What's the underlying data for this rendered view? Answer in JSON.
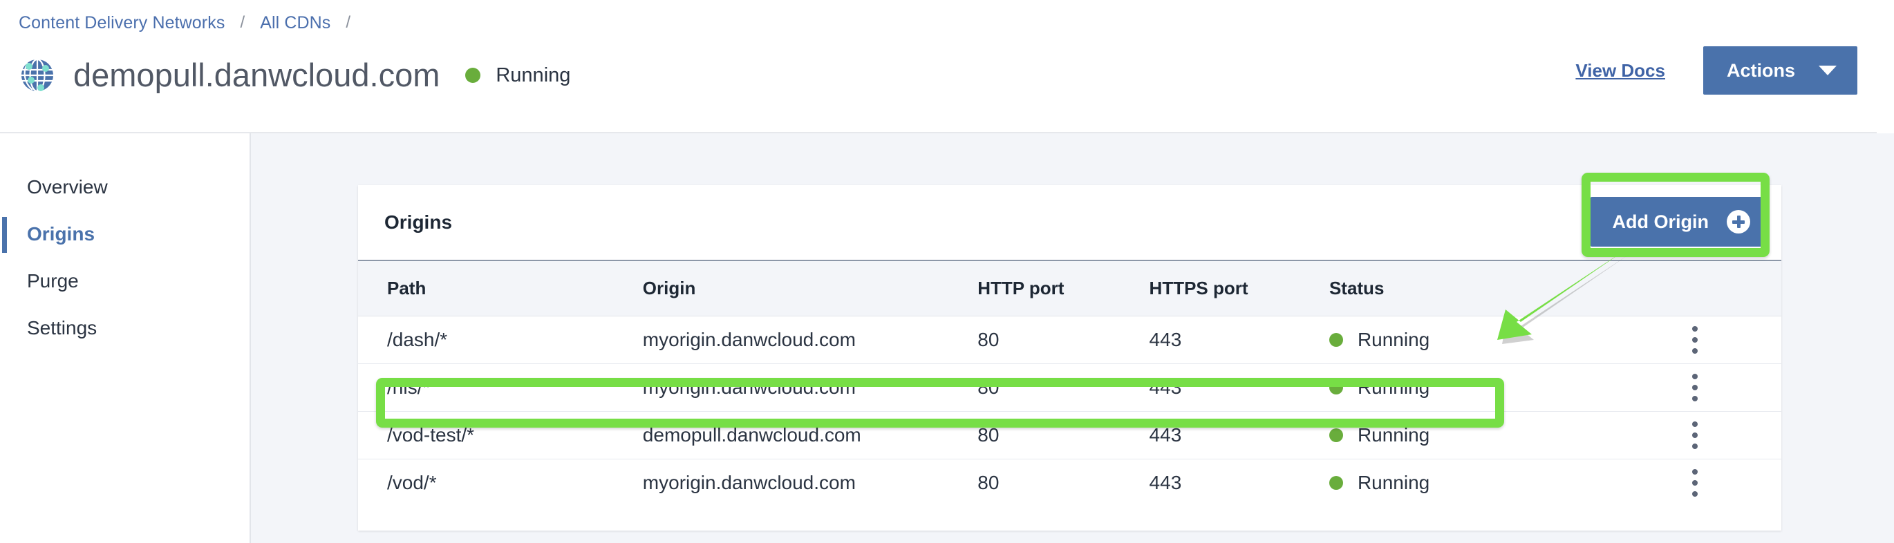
{
  "breadcrumb": {
    "items": [
      {
        "label": "Content Delivery Networks"
      },
      {
        "label": "All CDNs"
      }
    ],
    "separator": "/"
  },
  "header": {
    "icon": "globe-icon",
    "title": "demopull.danwcloud.com",
    "status": {
      "label": "Running",
      "color": "#69ad3c"
    },
    "view_docs_label": "View Docs",
    "actions_label": "Actions",
    "actions_caret": "chevron-down-icon"
  },
  "sidebar": {
    "items": [
      {
        "label": "Overview",
        "active": false
      },
      {
        "label": "Origins",
        "active": true
      },
      {
        "label": "Purge",
        "active": false
      },
      {
        "label": "Settings",
        "active": false
      }
    ],
    "active_color": "#4a72ab"
  },
  "card": {
    "title": "Origins",
    "add_origin_label": "Add Origin",
    "add_origin_icon": "plus-circle-icon"
  },
  "table": {
    "columns": [
      "Path",
      "Origin",
      "HTTP port",
      "HTTPS port",
      "Status",
      ""
    ],
    "rows": [
      {
        "path": "/dash/*",
        "origin": "myorigin.danwcloud.com",
        "http_port": "80",
        "https_port": "443",
        "status": "Running",
        "highlighted": false
      },
      {
        "path": "/hls/*",
        "origin": "myorigin.danwcloud.com",
        "http_port": "80",
        "https_port": "443",
        "status": "Running",
        "highlighted": true
      },
      {
        "path": "/vod-test/*",
        "origin": "demopull.danwcloud.com",
        "http_port": "80",
        "https_port": "443",
        "status": "Running",
        "highlighted": false
      },
      {
        "path": "/vod/*",
        "origin": "myorigin.danwcloud.com",
        "http_port": "80",
        "https_port": "443",
        "status": "Running",
        "highlighted": false
      }
    ],
    "row_menu_icon": "kebab-menu-icon",
    "status_dot_color": "#69ad3c"
  },
  "annotations": {
    "highlight_color": "#77de46",
    "boxes": [
      "add-origin-button",
      "hls-row"
    ],
    "arrow": "points from Add Origin button down-left to Status column"
  },
  "colors": {
    "brand_blue": "#4a72ab",
    "link_blue": "#4b6fad",
    "page_bg": "#f3f5f9",
    "card_bg": "#ffffff",
    "status_green": "#69ad3c",
    "annotation_green": "#77de46"
  }
}
